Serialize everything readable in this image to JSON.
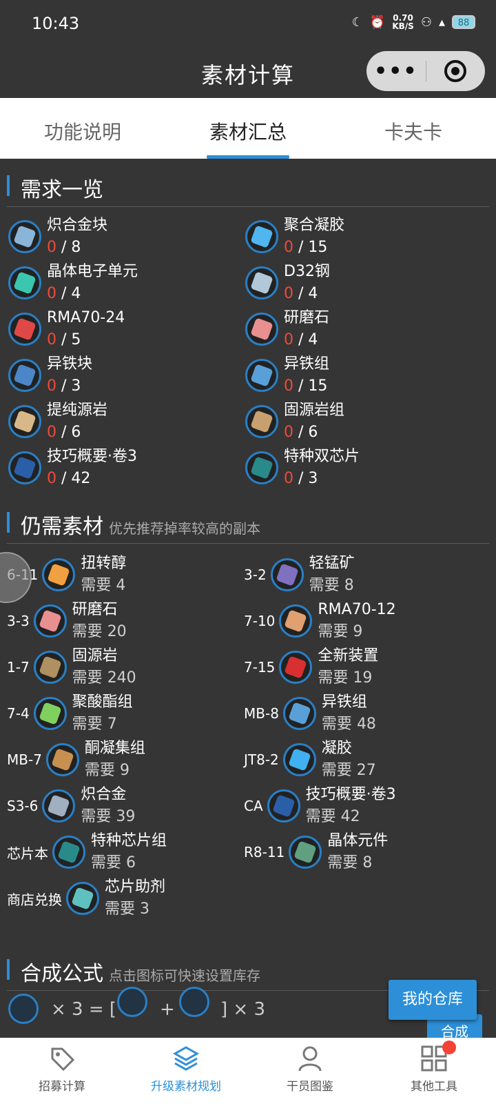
{
  "status": {
    "time": "10:43",
    "speed_value": "0.70",
    "speed_unit": "KB/S",
    "battery": "88"
  },
  "titlebar": {
    "title": "素材计算",
    "more_glyph": "•••"
  },
  "tabs": [
    {
      "label": "功能说明"
    },
    {
      "label": "素材汇总"
    },
    {
      "label": "卡夫卡"
    }
  ],
  "requirements": {
    "title": "需求一览",
    "items": [
      {
        "name": "炽合金块",
        "have": "0",
        "total": "8",
        "color": "#8ab4d8"
      },
      {
        "name": "聚合凝胶",
        "have": "0",
        "total": "15",
        "color": "#4fb6ef"
      },
      {
        "name": "晶体电子单元",
        "have": "0",
        "total": "4",
        "color": "#3bc6b0"
      },
      {
        "name": "D32钢",
        "have": "0",
        "total": "4",
        "color": "#b0c8d8"
      },
      {
        "name": "RMA70-24",
        "have": "0",
        "total": "5",
        "color": "#e04848"
      },
      {
        "name": "研磨石",
        "have": "0",
        "total": "4",
        "color": "#e89090"
      },
      {
        "name": "异铁块",
        "have": "0",
        "total": "3",
        "color": "#4b86c8"
      },
      {
        "name": "异铁组",
        "have": "0",
        "total": "15",
        "color": "#5aa0d8"
      },
      {
        "name": "提纯源岩",
        "have": "0",
        "total": "6",
        "color": "#d8b888"
      },
      {
        "name": "固源岩组",
        "have": "0",
        "total": "6",
        "color": "#c8a070"
      },
      {
        "name": "技巧概要·卷3",
        "have": "0",
        "total": "42",
        "color": "#2a5fa8"
      },
      {
        "name": "特种双芯片",
        "have": "0",
        "total": "3",
        "color": "#2a8a8a"
      }
    ]
  },
  "still_needed": {
    "title": "仍需素材",
    "subtitle": "优先推荐掉率较高的副本",
    "need_label": "需要",
    "items": [
      {
        "stage": "6-11",
        "name": "扭转醇",
        "count": "4",
        "color": "#f0a040"
      },
      {
        "stage": "3-2",
        "name": "轻锰矿",
        "count": "8",
        "color": "#8070c0"
      },
      {
        "stage": "3-3",
        "name": "研磨石",
        "count": "20",
        "color": "#e89090"
      },
      {
        "stage": "7-10",
        "name": "RMA70-12",
        "count": "9",
        "color": "#e0a070"
      },
      {
        "stage": "1-7",
        "name": "固源岩",
        "count": "240",
        "color": "#b09060"
      },
      {
        "stage": "7-15",
        "name": "全新装置",
        "count": "19",
        "color": "#d83030"
      },
      {
        "stage": "7-4",
        "name": "聚酸酯组",
        "count": "7",
        "color": "#80d060"
      },
      {
        "stage": "MB-8",
        "name": "异铁组",
        "count": "48",
        "color": "#5aa0d8"
      },
      {
        "stage": "MB-7",
        "name": "酮凝集组",
        "count": "9",
        "color": "#c89050"
      },
      {
        "stage": "JT8-2",
        "name": "凝胶",
        "count": "27",
        "color": "#40b0f0"
      },
      {
        "stage": "S3-6",
        "name": "炽合金",
        "count": "39",
        "color": "#a0b0c0"
      },
      {
        "stage": "CA",
        "name": "技巧概要·卷3",
        "count": "42",
        "color": "#2a5fa8"
      },
      {
        "stage": "芯片本",
        "name": "特种芯片组",
        "count": "6",
        "color": "#2a8a8a"
      },
      {
        "stage": "R8-11",
        "name": "晶体元件",
        "count": "8",
        "color": "#60a080"
      },
      {
        "stage": "商店兑换",
        "name": "芯片助剂",
        "count": "3",
        "color": "#60c0c0"
      }
    ]
  },
  "synthesis": {
    "title": "合成公式",
    "subtitle": "点击图标可快速设置库存",
    "formula_times": "× 3 = [",
    "formula_plus": "+",
    "formula_end": "] × 3"
  },
  "buttons": {
    "warehouse": "我的仓库",
    "synth": "合成"
  },
  "bottom_nav": [
    {
      "label": "招募计算"
    },
    {
      "label": "升级素材规划"
    },
    {
      "label": "干员图鉴"
    },
    {
      "label": "其他工具"
    }
  ]
}
